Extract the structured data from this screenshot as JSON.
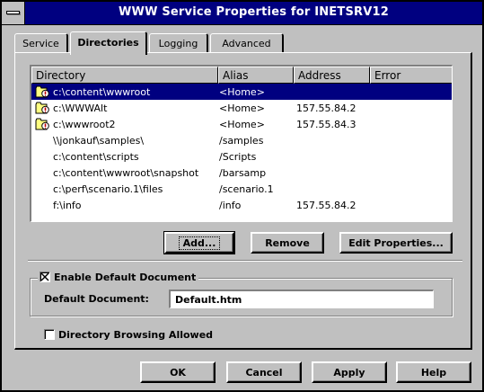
{
  "window": {
    "title": "WWW Service Properties for INETSRV12"
  },
  "tabs": [
    {
      "label": "Service",
      "active": false
    },
    {
      "label": "Directories",
      "active": true
    },
    {
      "label": "Logging",
      "active": false
    },
    {
      "label": "Advanced",
      "active": false
    }
  ],
  "directories": {
    "columns": [
      "Directory",
      "Alias",
      "Address",
      "Error"
    ],
    "rows": [
      {
        "directory": "c:\\content\\wwwroot",
        "alias": "<Home>",
        "address": "",
        "error": "",
        "icon": "warning-folder-icon",
        "selected": true
      },
      {
        "directory": "c:\\WWWAlt",
        "alias": "<Home>",
        "address": "157.55.84.2",
        "error": "",
        "icon": "warning-folder-icon",
        "selected": false
      },
      {
        "directory": "c:\\wwwroot2",
        "alias": "<Home>",
        "address": "157.55.84.3",
        "error": "",
        "icon": "warning-folder-icon",
        "selected": false
      },
      {
        "directory": "\\\\jonkauf\\samples\\",
        "alias": "/samples",
        "address": "",
        "error": "",
        "icon": "",
        "selected": false
      },
      {
        "directory": "c:\\content\\scripts",
        "alias": "/Scripts",
        "address": "",
        "error": "",
        "icon": "",
        "selected": false
      },
      {
        "directory": "c:\\content\\wwwroot\\snapshot",
        "alias": "/barsamp",
        "address": "",
        "error": "",
        "icon": "",
        "selected": false
      },
      {
        "directory": "c:\\perf\\scenario.1\\files",
        "alias": "/scenario.1",
        "address": "",
        "error": "",
        "icon": "",
        "selected": false
      },
      {
        "directory": "f:\\info",
        "alias": "/info",
        "address": "157.55.84.2",
        "error": "",
        "icon": "",
        "selected": false
      }
    ]
  },
  "list_buttons": {
    "add": "Add...",
    "remove": "Remove",
    "edit": "Edit Properties..."
  },
  "default_document": {
    "group_label": "Enable Default Document",
    "enabled": true,
    "field_label": "Default Document:",
    "value": "Default.htm"
  },
  "directory_browsing": {
    "label": "Directory Browsing Allowed",
    "checked": false
  },
  "footer_buttons": {
    "ok": "OK",
    "cancel": "Cancel",
    "apply": "Apply",
    "help": "Help"
  },
  "colors": {
    "face": "#c0c0c0",
    "title": "#000080",
    "selection": "#000080"
  }
}
